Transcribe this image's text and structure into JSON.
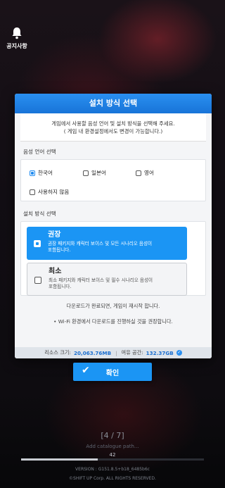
{
  "notice": {
    "label": "공지사항"
  },
  "dialog": {
    "title": "설치 방식 선택",
    "intro_line1": "게임에서 사용할 음성 언어 및 설치 방식을 선택해 주세요.",
    "intro_line2": "( 게임 내 환경설정에서도 변경이 가능합니다.)",
    "voice_section_title": "음성 언어 선택",
    "voice_options": [
      {
        "label": "한국어",
        "checked": true
      },
      {
        "label": "일본어",
        "checked": false
      },
      {
        "label": "영어",
        "checked": false
      },
      {
        "label": "사용하지 않음",
        "checked": false
      }
    ],
    "install_section_title": "설치 방식 선택",
    "install_options": [
      {
        "title": "권장",
        "desc_line1": "권장 패키지와 캐릭터 보이스 및 모든 시나리오 음성이",
        "desc_line2": "포함됩니다.",
        "selected": true
      },
      {
        "title": "최소",
        "desc_line1": "최소 패키지와 캐릭터 보이스 및 필수 시나리오 음성이",
        "desc_line2": "포함됩니다.",
        "selected": false
      }
    ],
    "note1": "다운로드가 완료되면, 게임이 재시작 합니다.",
    "note2": "• Wi-Fi 환경에서 다운로드를 진행하실 것을 권장합니다.",
    "size_label": "리소스 크기:",
    "size_value": "20,063.76MB",
    "free_label": "여유 공간:",
    "free_value": "132.37GB"
  },
  "confirm_label": "확인",
  "progress": {
    "page": "[4 / 7]",
    "path": "Add catalogue path...",
    "percent_text": "42",
    "fraction": 0.42
  },
  "footer": {
    "version": "VERSION : G151.8.5+b18_6485b6c",
    "copyright": "©SHIFT UP Corp. ALL RIGHTS RESERVED."
  }
}
